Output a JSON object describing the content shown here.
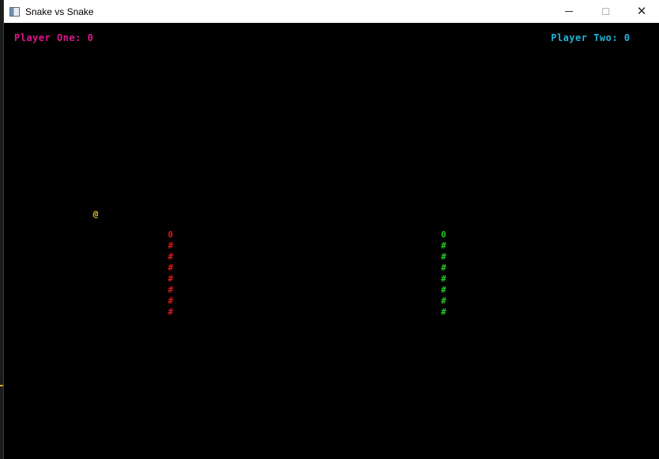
{
  "window": {
    "title": "Snake vs Snake",
    "controls": {
      "minimize": "—",
      "maximize": "☐",
      "close": "✕"
    }
  },
  "scores": {
    "player_one": "Player One: 0",
    "player_two": "Player Two: 0"
  },
  "food": {
    "glyph": "@",
    "color": "#f0c020"
  },
  "snake_one": {
    "color": "#e01818",
    "head": "0",
    "body": [
      "#",
      "#",
      "#",
      "#",
      "#",
      "#",
      "#"
    ]
  },
  "snake_two": {
    "color": "#28c828",
    "head": "0",
    "body": [
      "#",
      "#",
      "#",
      "#",
      "#",
      "#",
      "#"
    ]
  }
}
